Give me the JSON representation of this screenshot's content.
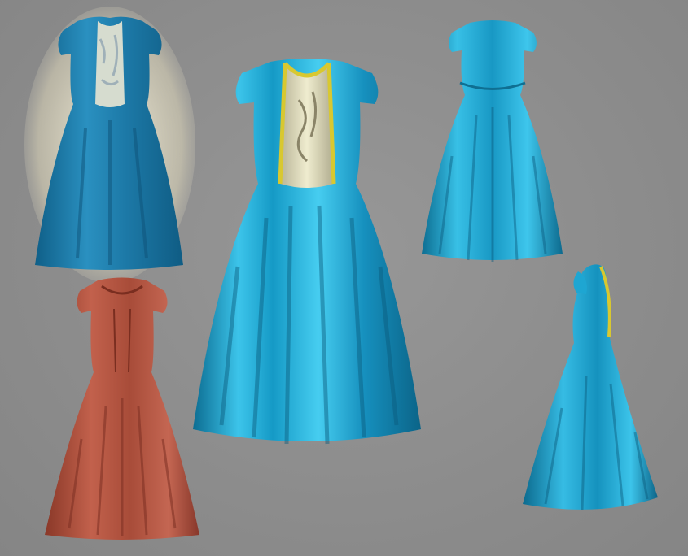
{
  "scene": {
    "background_color": "#8e8e8e",
    "description_free": true
  },
  "dresses": [
    {
      "id": "photo-reference",
      "main_color": "#1f7fae",
      "accent_color": "#cfd6c8"
    },
    {
      "id": "clay-render",
      "main_color": "#b0533f",
      "accent_color": "#8e3a2a"
    },
    {
      "id": "hero-render",
      "main_color": "#1aa7d3",
      "accent_color": "#d8c830"
    },
    {
      "id": "back-view",
      "main_color": "#1aa3cf",
      "accent_color": "#0f6f92"
    },
    {
      "id": "side-view",
      "main_color": "#1aa3cf",
      "accent_color": "#d8c830"
    }
  ]
}
